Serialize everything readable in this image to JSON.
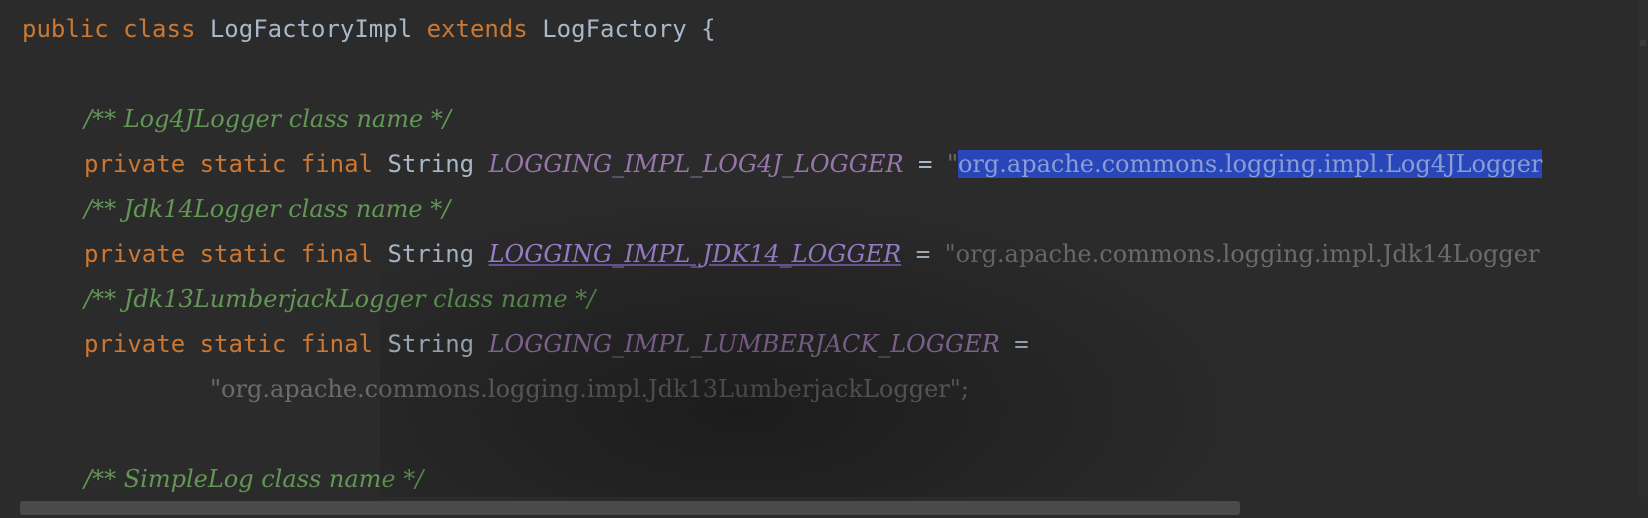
{
  "editor": {
    "lines": [
      {
        "parts": [
          "public",
          "class",
          "LogFactoryImpl",
          "extends",
          "LogFactory",
          "{"
        ]
      },
      {
        "comment": "/** Log4JLogger class name */"
      },
      {
        "modifiers": "private static final",
        "type": "String",
        "field": "LOGGING_IMPL_LOG4J_LOGGER",
        "eq": "=",
        "quote": "\"",
        "value": "org.apache.commons.logging.impl.Log4JLogger"
      },
      {
        "comment": "/** Jdk14Logger class name */"
      },
      {
        "modifiers": "private static final",
        "type": "String",
        "field": "LOGGING_IMPL_JDK14_LOGGER",
        "eq": "=",
        "quote": "\"",
        "value": "org.apache.commons.logging.impl.Jdk14Logger"
      },
      {
        "comment": "/** Jdk13LumberjackLogger class name */"
      },
      {
        "modifiers": "private static final",
        "type": "String",
        "field": "LOGGING_IMPL_LUMBERJACK_LOGGER",
        "eq": "="
      },
      {
        "value": "\"org.apache.commons.logging.impl.Jdk13LumberjackLogger\";"
      },
      {
        "comment": "/** SimpleLog class name */"
      }
    ]
  }
}
